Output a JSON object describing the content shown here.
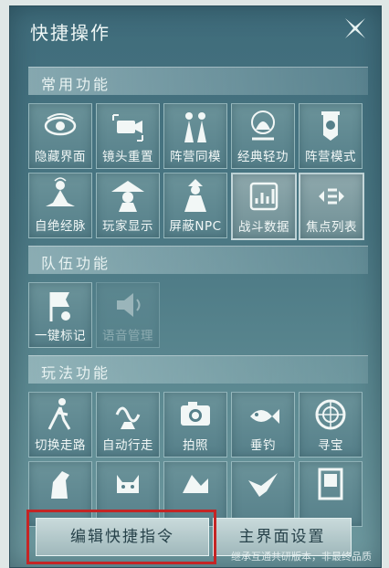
{
  "header": {
    "title": "快捷操作"
  },
  "sections": {
    "common": {
      "label": "常用功能",
      "items": [
        {
          "label": "隐藏界面",
          "icon": "eye-icon"
        },
        {
          "label": "镜头重置",
          "icon": "camera-icon"
        },
        {
          "label": "阵营同模",
          "icon": "twin-figures-icon"
        },
        {
          "label": "经典轻功",
          "icon": "lightness-skill-icon"
        },
        {
          "label": "阵营模式",
          "icon": "banner-icon"
        },
        {
          "label": "自绝经脉",
          "icon": "meditation-icon"
        },
        {
          "label": "玩家显示",
          "icon": "bamboo-hat-icon"
        },
        {
          "label": "屏蔽NPC",
          "icon": "npc-figure-icon"
        },
        {
          "label": "战斗数据",
          "icon": "battle-data-icon"
        },
        {
          "label": "焦点列表",
          "icon": "focus-list-icon"
        }
      ]
    },
    "team": {
      "label": "队伍功能",
      "items": [
        {
          "label": "一键标记",
          "icon": "mark-icon"
        },
        {
          "label": "语音管理",
          "icon": "voice-icon"
        }
      ]
    },
    "gameplay": {
      "label": "玩法功能",
      "items": [
        {
          "label": "切换走路",
          "icon": "walk-icon"
        },
        {
          "label": "自动行走",
          "icon": "auto-walk-icon"
        },
        {
          "label": "拍照",
          "icon": "photo-icon"
        },
        {
          "label": "垂钓",
          "icon": "fishing-icon"
        },
        {
          "label": "寻宝",
          "icon": "treasure-icon"
        },
        {
          "label": "",
          "icon": "horse-icon"
        },
        {
          "label": "",
          "icon": "cat-icon"
        },
        {
          "label": "",
          "icon": "pet-icon"
        },
        {
          "label": "",
          "icon": "bird-icon"
        },
        {
          "label": "",
          "icon": "furniture-icon"
        }
      ]
    }
  },
  "footer": {
    "edit_label": "编辑快捷指令",
    "main_settings_label": "主界面设置",
    "watermark": "继承互通共研版本，非最终品质"
  },
  "colors": {
    "highlight": "#c42525",
    "panel": "#4a7783"
  }
}
